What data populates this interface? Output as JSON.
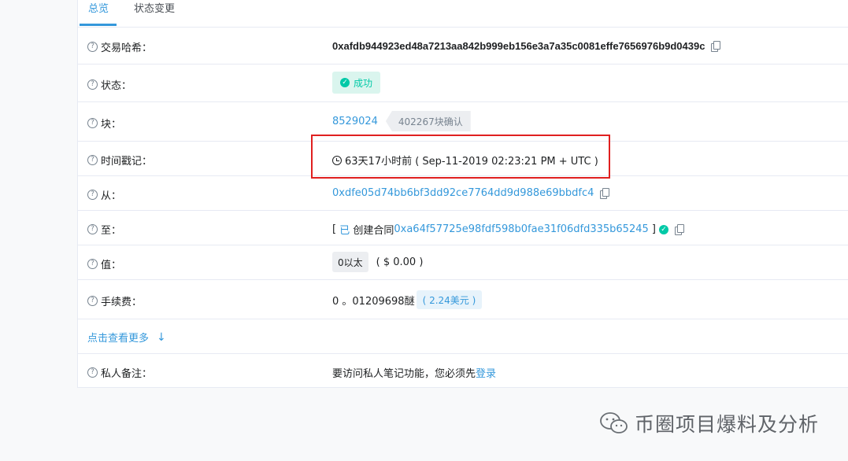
{
  "tabs": [
    {
      "label": "总览",
      "active": true
    },
    {
      "label": "状态变更",
      "active": false
    }
  ],
  "rows": {
    "tx_hash": {
      "label": "交易哈希：",
      "value": "0xafdb944923ed48a7213aa842b999eb156e3a7a35c0081effe7656976b9d0439c"
    },
    "status": {
      "label": "状态：",
      "value": "成功"
    },
    "block": {
      "label": "块：",
      "value": "8529024",
      "confirmations": "402267块确认"
    },
    "timestamp": {
      "label": "时间戳记：",
      "value": "63天17小时前 ( Sep-11-2019 02:23:21 PM + UTC )"
    },
    "from": {
      "label": "从：",
      "value": "0xdfe05d74bb6bf3dd92ce7764dd9d988e69bbdfc4"
    },
    "to": {
      "label": "至：",
      "prefix": "[ ",
      "created_icon": "已",
      "created_text": " 创建合同",
      "contract": "0xa64f57725e98fdf598b0fae31f06dfd335b65245",
      "suffix": " ]"
    },
    "value": {
      "label": "值：",
      "amount": "0以太",
      "usd": "( $ 0.00 )"
    },
    "fee": {
      "label": "手续费：",
      "amount": "0 。01209698醚",
      "usd": "( 2.24美元 )"
    }
  },
  "more": {
    "label": "点击查看更多"
  },
  "note": {
    "label": "私人备注：",
    "text": "要访问私人笔记功能，您必须先",
    "login": "登录"
  },
  "watermark": {
    "text": "币圈项目爆料及分析"
  },
  "colors": {
    "accent": "#3498db",
    "success": "#00c9a7",
    "highlight": "#e02020",
    "border": "#e7eaf3"
  },
  "icons": [
    "help-icon",
    "copy-icon",
    "check-circle-icon",
    "clock-icon",
    "arrow-down-icon",
    "wechat-logo-icon"
  ]
}
